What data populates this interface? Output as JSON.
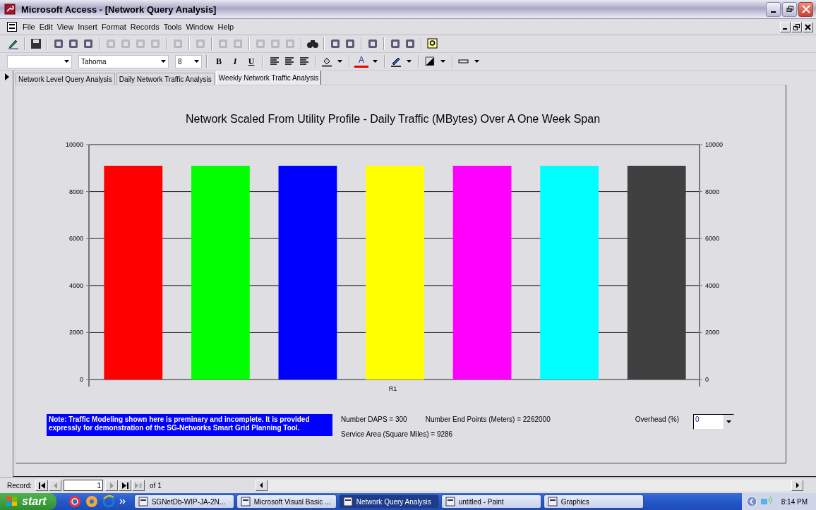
{
  "window": {
    "title": "Microsoft Access - [Network Query Analysis]"
  },
  "menu": [
    "File",
    "Edit",
    "View",
    "Insert",
    "Format",
    "Records",
    "Tools",
    "Window",
    "Help"
  ],
  "format_toolbar": {
    "font": "Tahoma",
    "size": "8",
    "bold": "B",
    "italic": "I",
    "underline": "U",
    "font_color": "A"
  },
  "tabs": [
    {
      "label": "Network Level Query Analysis",
      "selected": false
    },
    {
      "label": "Daily Network Traffic Analysis",
      "selected": false
    },
    {
      "label": "Weekly Network Traffic Analysis",
      "selected": true
    }
  ],
  "chart": {
    "chart_data": {
      "type": "bar",
      "title": "Network Scaled From Utility Profile - Daily Traffic (MBytes) Over A One Week Span",
      "categories": [
        "R1"
      ],
      "ylim": [
        0,
        10000
      ],
      "yticks": [
        0,
        2000,
        4000,
        6000,
        8000,
        10000
      ],
      "grid": true,
      "series": [
        {
          "color": "#ff0000",
          "values": [
            9100
          ]
        },
        {
          "color": "#00ff00",
          "values": [
            9100
          ]
        },
        {
          "color": "#0000ff",
          "values": [
            9100
          ]
        },
        {
          "color": "#ffff00",
          "values": [
            9100
          ]
        },
        {
          "color": "#ff00ff",
          "values": [
            9100
          ]
        },
        {
          "color": "#00ffff",
          "values": [
            9100
          ]
        },
        {
          "color": "#404040",
          "values": [
            9100
          ]
        }
      ]
    },
    "right_axis_labels": [
      "10000",
      "8000",
      "6000",
      "4000",
      "2000",
      "0"
    ]
  },
  "note": "Note: Traffic Modeling shown here is preminary and incomplete. It is  provided expressly for demonstration of the SG-Networks Smart Grid Planning Tool.",
  "stats": {
    "daps": "Number DAPS = 300",
    "end_points": "Number End Points (Meters) = 2262000",
    "service_area": "Service Area (Square Miles) = 9286"
  },
  "overhead": {
    "label": "Overhead (%)",
    "value": "0"
  },
  "record_nav": {
    "label": "Record:",
    "current": "1",
    "total": "of 1"
  },
  "taskbar": {
    "start": "start",
    "items": [
      {
        "label": "SGNetDb-WIP-JA-2N...",
        "selected": false
      },
      {
        "label": "Microsoft Visual Basic ...",
        "selected": false
      },
      {
        "label": "Network Query Analysis",
        "selected": true
      },
      {
        "label": "untitled - Paint",
        "selected": false
      },
      {
        "label": "Graphics",
        "selected": false
      }
    ],
    "clock": "8:14 PM"
  }
}
